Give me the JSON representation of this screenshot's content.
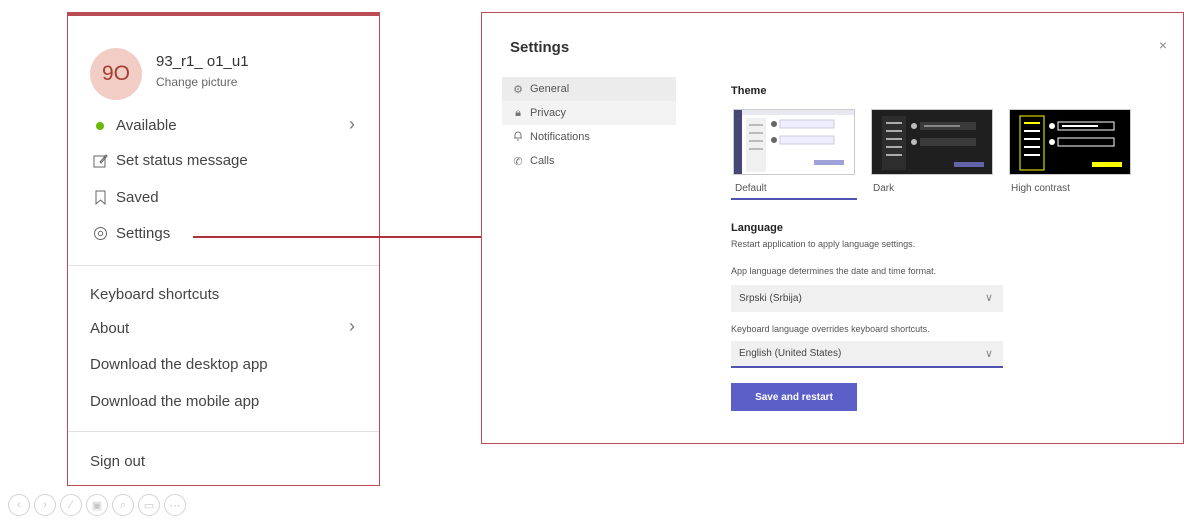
{
  "profile_menu": {
    "avatar_initials": "9O",
    "user_name": "93_r1_ o1_u1",
    "change_picture": "Change picture",
    "status": {
      "label": "Available",
      "color": "#6bb700"
    },
    "set_status": "Set status message",
    "saved": "Saved",
    "settings": "Settings",
    "keyboard_shortcuts": "Keyboard shortcuts",
    "about": "About",
    "download_desktop": "Download the desktop app",
    "download_mobile": "Download the mobile app",
    "sign_out": "Sign out"
  },
  "settings_dialog": {
    "title": "Settings",
    "close": "×",
    "nav": [
      {
        "label": "General",
        "icon": "gear-icon"
      },
      {
        "label": "Privacy",
        "icon": "lock-icon"
      },
      {
        "label": "Notifications",
        "icon": "bell-icon"
      },
      {
        "label": "Calls",
        "icon": "phone-icon"
      }
    ],
    "theme": {
      "heading": "Theme",
      "options": [
        "Default",
        "Dark",
        "High contrast"
      ],
      "selected": "Default"
    },
    "language": {
      "heading": "Language",
      "restart_note": "Restart application to apply language settings.",
      "app_language_note": "App language determines the date and time format.",
      "app_language_value": "Srpski (Srbija)",
      "keyboard_note": "Keyboard language overrides keyboard shortcuts.",
      "keyboard_value": "English (United States)"
    },
    "save_button": "Save and restart"
  },
  "colors": {
    "highlight_border": "#b94c55",
    "accent": "#5b5fc7",
    "avatar_bg": "#f1cdc5"
  }
}
